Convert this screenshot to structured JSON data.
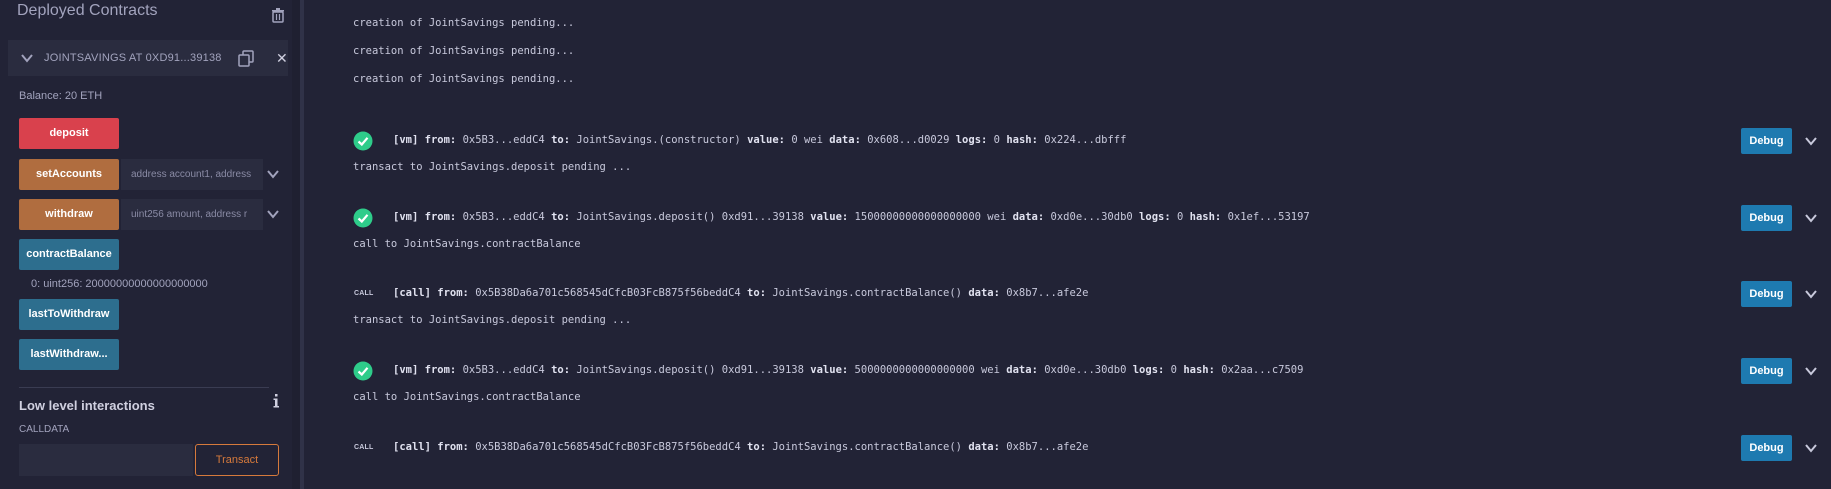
{
  "left_panel": {
    "title": "Deployed Contracts",
    "instance": {
      "name": "JOINTSAVINGS AT 0XD91...39138",
      "balance": "Balance: 20 ETH",
      "functions": [
        {
          "label": "deposit",
          "color": "red",
          "placeholder": ""
        },
        {
          "label": "setAccounts",
          "color": "orange",
          "placeholder": "address account1, address"
        },
        {
          "label": "withdraw",
          "color": "orange",
          "placeholder": "uint256 amount, address r"
        },
        {
          "label": "contractBalance",
          "color": "blue",
          "placeholder": ""
        },
        {
          "label": "lastToWithdraw",
          "color": "blue",
          "placeholder": ""
        },
        {
          "label": "lastWithdraw...",
          "color": "blue",
          "placeholder": ""
        }
      ],
      "contract_balance_result": "0: uint256: 20000000000000000000"
    },
    "low_level": {
      "title": "Low level interactions",
      "calldata_label": "CALLDATA",
      "calldata_value": "",
      "transact_label": "Transact"
    }
  },
  "terminal": {
    "pending_lines": [
      "creation of JointSavings pending...",
      "creation of JointSavings pending...",
      "creation of JointSavings pending..."
    ],
    "entries": [
      {
        "tag": "[vm]",
        "parts": [
          {
            "k": "from:",
            "v": "0x5B3...eddC4"
          },
          {
            "k": "to:",
            "v": "JointSavings.(constructor)"
          },
          {
            "k": "value:",
            "v": "0 wei"
          },
          {
            "k": "data:",
            "v": "0x608...d0029"
          },
          {
            "k": "logs:",
            "v": "0"
          },
          {
            "k": "hash:",
            "v": "0x224...dbfff"
          }
        ],
        "after": "transact to JointSavings.deposit pending ..."
      },
      {
        "tag": "[vm]",
        "parts": [
          {
            "k": "from:",
            "v": "0x5B3...eddC4"
          },
          {
            "k": "to:",
            "v": "JointSavings.deposit() 0xd91...39138"
          },
          {
            "k": "value:",
            "v": "15000000000000000000 wei"
          },
          {
            "k": "data:",
            "v": "0xd0e...30db0"
          },
          {
            "k": "logs:",
            "v": "0"
          },
          {
            "k": "hash:",
            "v": "0x1ef...53197"
          }
        ],
        "after": "call to JointSavings.contractBalance"
      },
      {
        "tag": "[call]",
        "parts": [
          {
            "k": "from:",
            "v": "0x5B38Da6a701c568545dCfcB03FcB875f56beddC4"
          },
          {
            "k": "to:",
            "v": "JointSavings.contractBalance()"
          },
          {
            "k": "data:",
            "v": "0x8b7...afe2e"
          }
        ],
        "after": "transact to JointSavings.deposit pending ..."
      },
      {
        "tag": "[vm]",
        "parts": [
          {
            "k": "from:",
            "v": "0x5B3...eddC4"
          },
          {
            "k": "to:",
            "v": "JointSavings.deposit() 0xd91...39138"
          },
          {
            "k": "value:",
            "v": "5000000000000000000 wei"
          },
          {
            "k": "data:",
            "v": "0xd0e...30db0"
          },
          {
            "k": "logs:",
            "v": "0"
          },
          {
            "k": "hash:",
            "v": "0x2aa...c7509"
          }
        ],
        "after": "call to JointSavings.contractBalance"
      },
      {
        "tag": "[call]",
        "parts": [
          {
            "k": "from:",
            "v": "0x5B38Da6a701c568545dCfcB03FcB875f56beddC4"
          },
          {
            "k": "to:",
            "v": "JointSavings.contractBalance()"
          },
          {
            "k": "data:",
            "v": "0x8b7...afe2e"
          }
        ],
        "after": ""
      }
    ],
    "call_badge": "CALL",
    "debug_label": "Debug"
  },
  "colors": {
    "deposit": "#d9414d",
    "payable": "#b06d3f",
    "view": "#2d6e8e",
    "debug": "#1e7ab0",
    "success": "#2ecc8a",
    "transact": "#d67a3c"
  },
  "icons": [
    "trash-icon",
    "chevron-down-icon",
    "copy-icon",
    "close-icon",
    "info-icon",
    "check-circle-icon"
  ]
}
